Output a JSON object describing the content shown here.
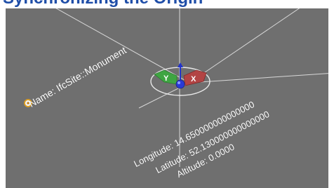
{
  "header": {
    "heading_text": "Synchronizing the Origin"
  },
  "viewport": {
    "background_color": "#6f6f6f",
    "site_name": "Name: IfcSite::Monument",
    "longitude": "Longitude: 14.650000000000000",
    "latitude": "Latitude: 52.130000000000000",
    "altitude": "Altitude: 0.0000",
    "gizmo": {
      "x_label": "X",
      "y_label": "Y",
      "x_color": "#b24444",
      "y_color": "#3fa542",
      "z_color": "#2233cc"
    },
    "marker_icon": "location-marker-icon"
  }
}
